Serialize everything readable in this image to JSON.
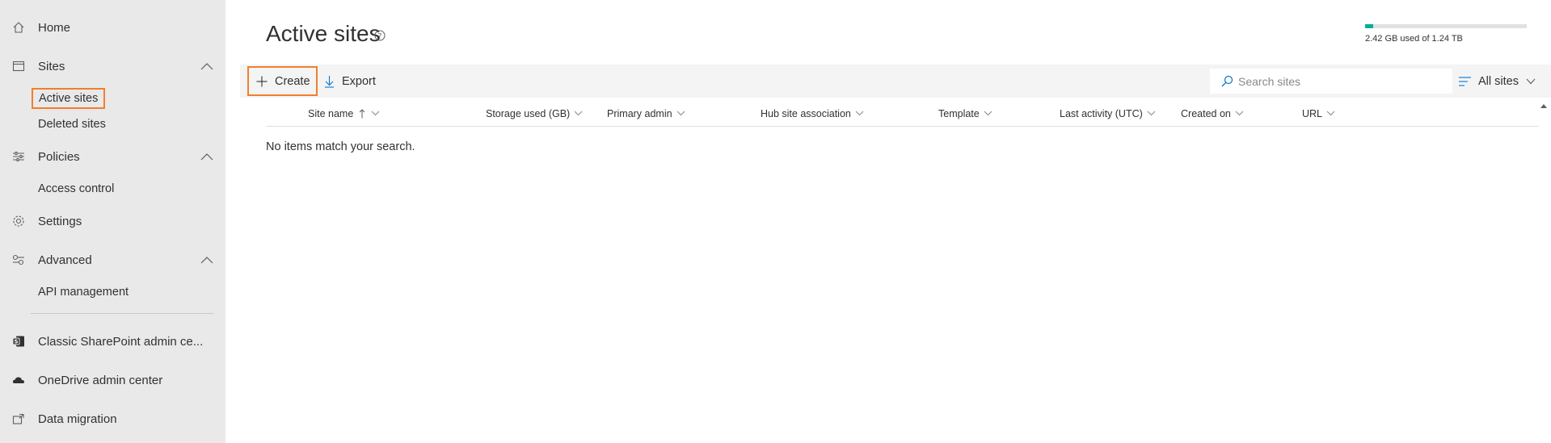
{
  "sidebar": {
    "home": {
      "label": "Home",
      "icon": "home-icon"
    },
    "sites": {
      "label": "Sites",
      "icon": "sites-icon",
      "expanded": true,
      "children": [
        {
          "label": "Active sites",
          "active": true
        },
        {
          "label": "Deleted sites"
        }
      ]
    },
    "policies": {
      "label": "Policies",
      "icon": "policies-icon",
      "expanded": true,
      "children": [
        {
          "label": "Access control"
        }
      ]
    },
    "settings": {
      "label": "Settings",
      "icon": "gear-icon"
    },
    "advanced": {
      "label": "Advanced",
      "icon": "advanced-icon",
      "expanded": true,
      "children": [
        {
          "label": "API management"
        }
      ]
    },
    "classic": {
      "label": "Classic SharePoint admin ce...",
      "icon": "sharepoint-icon"
    },
    "onedrive": {
      "label": "OneDrive admin center",
      "icon": "onedrive-icon"
    },
    "migration": {
      "label": "Data migration",
      "icon": "migration-icon"
    }
  },
  "page": {
    "title": "Active sites"
  },
  "storage": {
    "text": "2.42 GB used of 1.24 TB",
    "used_fraction": 0.05,
    "color": "#00ad9b"
  },
  "toolbar": {
    "create_label": "Create",
    "export_label": "Export",
    "search_placeholder": "Search sites",
    "view_label": "All sites"
  },
  "table": {
    "columns": [
      {
        "label": "Site name",
        "sorted": "asc"
      },
      {
        "label": "Storage used (GB)"
      },
      {
        "label": "Primary admin"
      },
      {
        "label": "Hub site association"
      },
      {
        "label": "Template"
      },
      {
        "label": "Last activity (UTC)"
      },
      {
        "label": "Created on"
      },
      {
        "label": "URL"
      }
    ],
    "empty_message": "No items match your search."
  },
  "colors": {
    "highlight": "#f07f2c",
    "sidebar_bg": "#e9e9e9",
    "accent": "#0078d4"
  }
}
